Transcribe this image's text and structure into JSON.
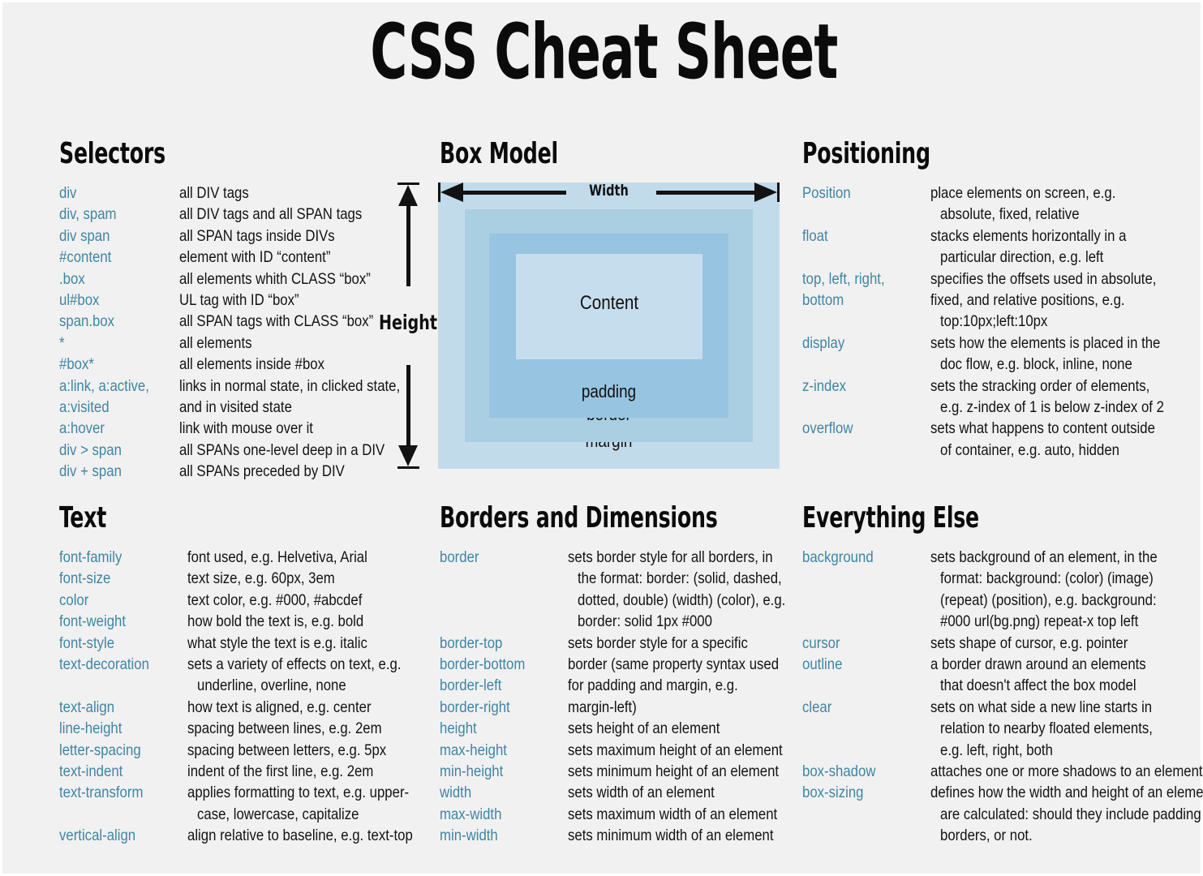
{
  "title": "CSS Cheat Sheet",
  "colors": {
    "background": "#f1f1f1",
    "property": "#3f85a3",
    "text": "#131313",
    "margin_box": "#c2dbeb",
    "border_box": "#aacee2",
    "padding_box": "#97c4e0",
    "content_box": "#c6dded"
  },
  "sections": {
    "selectors": {
      "heading": "Selectors",
      "rows": [
        {
          "prop": "div",
          "desc": "all DIV tags"
        },
        {
          "prop": "div, spam",
          "desc": "all DIV tags and all SPAN tags"
        },
        {
          "prop": "div span",
          "desc": "all SPAN tags inside DIVs"
        },
        {
          "prop": "#content",
          "desc": "element with ID “content”"
        },
        {
          "prop": ".box",
          "desc": "all elements whith CLASS “box”"
        },
        {
          "prop": "ul#box",
          "desc": "UL tag with ID “box”"
        },
        {
          "prop": "span.box",
          "desc": "all SPAN tags with CLASS “box”"
        },
        {
          "prop": "*",
          "desc": "all elements"
        },
        {
          "prop": "#box*",
          "desc": "all elements inside #box"
        },
        {
          "prop": "a:link, a:active,",
          "desc": "links in normal state, in clicked state,"
        },
        {
          "prop": "a:visited",
          "desc": "and in visited state"
        },
        {
          "prop": "a:hover",
          "desc": "link with mouse over it"
        },
        {
          "prop": "div > span",
          "desc": "all SPANs one-level deep in a DIV"
        },
        {
          "prop": "div + span",
          "desc": "all SPANs preceded by DIV"
        }
      ]
    },
    "box_model": {
      "heading": "Box Model",
      "width_label": "Width",
      "height_label": "Height",
      "layers": [
        {
          "name": "content",
          "label": "Content"
        },
        {
          "name": "padding",
          "label": "padding"
        },
        {
          "name": "border",
          "label": "border"
        },
        {
          "name": "margin",
          "label": "margin"
        }
      ]
    },
    "positioning": {
      "heading": "Positioning",
      "rows": [
        {
          "prop": "Position",
          "desc": "place elements on screen, e.g."
        },
        {
          "prop": "",
          "desc": "absolute, fixed, relative"
        },
        {
          "prop": "float",
          "desc": "stacks elements horizontally in a"
        },
        {
          "prop": "",
          "desc": "particular direction, e.g. left"
        },
        {
          "prop": "top, left, right,",
          "desc": "specifies the offsets used in absolute,"
        },
        {
          "prop": "bottom",
          "desc": "fixed, and relative positions, e.g."
        },
        {
          "prop": "",
          "desc": "top:10px;left:10px"
        },
        {
          "prop": "display",
          "desc": "sets how the elements is placed in the"
        },
        {
          "prop": "",
          "desc": "doc flow, e.g. block, inline, none"
        },
        {
          "prop": "z-index",
          "desc": "sets the stracking order of elements,"
        },
        {
          "prop": "",
          "desc": "e.g. z-index of 1 is below z-index of 2"
        },
        {
          "prop": "overflow",
          "desc": "sets what happens to content outside"
        },
        {
          "prop": "",
          "desc": "of container, e.g. auto, hidden"
        }
      ]
    },
    "text": {
      "heading": "Text",
      "rows": [
        {
          "prop": "font-family",
          "desc": "font used, e.g. Helvetiva, Arial"
        },
        {
          "prop": "font-size",
          "desc": "text size, e.g. 60px, 3em"
        },
        {
          "prop": "color",
          "desc": "text color, e.g. #000, #abcdef"
        },
        {
          "prop": "font-weight",
          "desc": "how bold the text is, e.g. bold"
        },
        {
          "prop": "font-style",
          "desc": "what style the text is e.g. italic"
        },
        {
          "prop": "text-decoration",
          "desc": "sets a variety of effects on text, e.g."
        },
        {
          "prop": "",
          "desc": "underline, overline, none"
        },
        {
          "prop": "text-align",
          "desc": "how text is aligned, e.g. center"
        },
        {
          "prop": "line-height",
          "desc": "spacing between lines, e.g. 2em"
        },
        {
          "prop": "letter-spacing",
          "desc": "spacing between letters, e.g. 5px"
        },
        {
          "prop": "text-indent",
          "desc": "indent of the first line, e.g. 2em"
        },
        {
          "prop": "text-transform",
          "desc": "applies formatting to text, e.g. upper-"
        },
        {
          "prop": "",
          "desc": "case, lowercase, capitalize"
        },
        {
          "prop": "vertical-align",
          "desc": "align relative to baseline, e.g. text-top"
        }
      ]
    },
    "borders": {
      "heading": "Borders and Dimensions",
      "rows": [
        {
          "prop": "border",
          "desc": "sets border style for all borders, in"
        },
        {
          "prop": "",
          "desc": "the format: border: (solid, dashed,"
        },
        {
          "prop": "",
          "desc": "dotted, double) (width) (color), e.g."
        },
        {
          "prop": "",
          "desc": "border: solid 1px #000"
        },
        {
          "prop": "border-top",
          "desc": "sets border style for a specific"
        },
        {
          "prop": "border-bottom",
          "desc": "border (same property syntax used"
        },
        {
          "prop": "border-left",
          "desc": "for padding and margin, e.g."
        },
        {
          "prop": "border-right",
          "desc": "margin-left)"
        },
        {
          "prop": "height",
          "desc": "sets height of an element"
        },
        {
          "prop": "max-height",
          "desc": "sets maximum height of an element"
        },
        {
          "prop": "min-height",
          "desc": "sets minimum height of an element"
        },
        {
          "prop": "width",
          "desc": "sets width of an element"
        },
        {
          "prop": "max-width",
          "desc": "sets maximum width of an element"
        },
        {
          "prop": "min-width",
          "desc": "sets minimum width of an element"
        }
      ]
    },
    "everything_else": {
      "heading": "Everything Else",
      "rows": [
        {
          "prop": "background",
          "desc": "sets background of an element, in the"
        },
        {
          "prop": "",
          "desc": "format: background: (color) (image)"
        },
        {
          "prop": "",
          "desc": "(repeat) (position), e.g. background:"
        },
        {
          "prop": "",
          "desc": "#000 url(bg.png) repeat-x top left"
        },
        {
          "prop": "cursor",
          "desc": "sets shape of cursor, e.g. pointer"
        },
        {
          "prop": "outline",
          "desc": "a border drawn around an elements"
        },
        {
          "prop": "",
          "desc": "that doesn't affect the box model"
        },
        {
          "prop": "clear",
          "desc": "sets on what side a new line starts in"
        },
        {
          "prop": "",
          "desc": "relation to nearby floated elements,"
        },
        {
          "prop": "",
          "desc": "e.g. left, right, both"
        },
        {
          "prop": "box-shadow",
          "desc": "attaches one or more shadows to an element"
        },
        {
          "prop": "box-sizing",
          "desc": "defines how the width and height of an element"
        },
        {
          "prop": "",
          "desc": "are calculated: should they include padding and"
        },
        {
          "prop": "",
          "desc": "borders, or not."
        }
      ]
    }
  }
}
